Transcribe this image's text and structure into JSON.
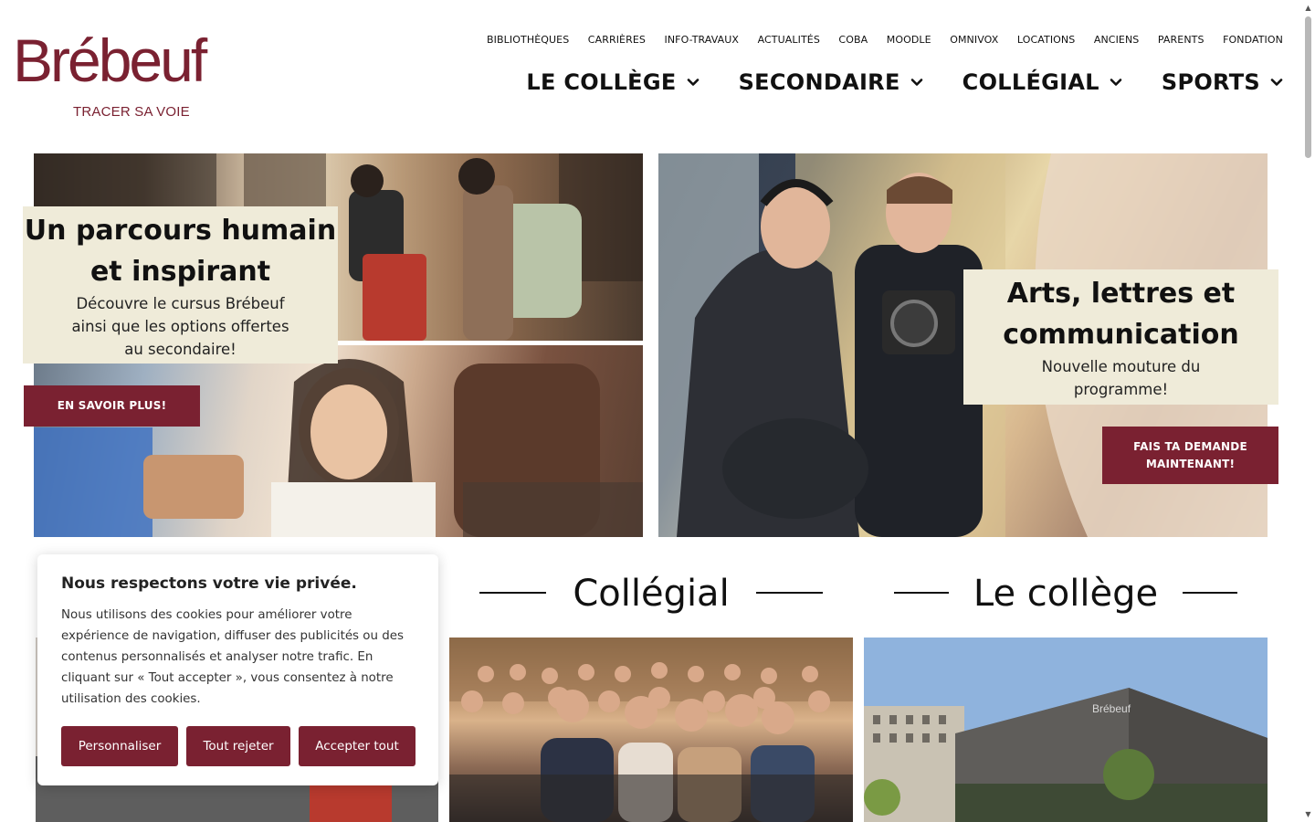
{
  "brand": {
    "logo_text": "Brébeuf",
    "tagline": "TRACER SA VOIE",
    "color": "#7a2131"
  },
  "utility_nav": [
    "BIBLIOTHÈQUES",
    "CARRIÈRES",
    "INFO-TRAVAUX",
    "ACTUALITÉS",
    "COBA",
    "MOODLE",
    "OMNIVOX",
    "LOCATIONS",
    "ANCIENS",
    "PARENTS",
    "FONDATION"
  ],
  "main_nav": [
    "LE COLLÈGE",
    "SECONDAIRE",
    "COLLÉGIAL",
    "SPORTS"
  ],
  "hero_left": {
    "title_line1": "Un parcours humain",
    "title_line2": "et inspirant",
    "sub_line1": "Découvre le cursus Brébeuf",
    "sub_line2": "ainsi que les options offertes",
    "sub_line3": "au secondaire!",
    "button": "EN SAVOIR PLUS!"
  },
  "hero_right": {
    "title_line1": "Arts, lettres et",
    "title_line2": "communication",
    "sub_line1": "Nouvelle mouture du",
    "sub_line2": "programme!",
    "button": "FAIS TA DEMANDE MAINTENANT!"
  },
  "sections": {
    "collegial": "Collégial",
    "college": "Le collège"
  },
  "cookie": {
    "title": "Nous respectons votre vie privée.",
    "text": "Nous utilisons des cookies pour améliorer votre expérience de navigation, diffuser des publicités ou des contenus personnalisés et analyser notre trafic. En cliquant sur « Tout accepter », vous consentez à notre utilisation des cookies.",
    "btn_customize": "Personnaliser",
    "btn_reject": "Tout rejeter",
    "btn_accept": "Accepter tout"
  }
}
